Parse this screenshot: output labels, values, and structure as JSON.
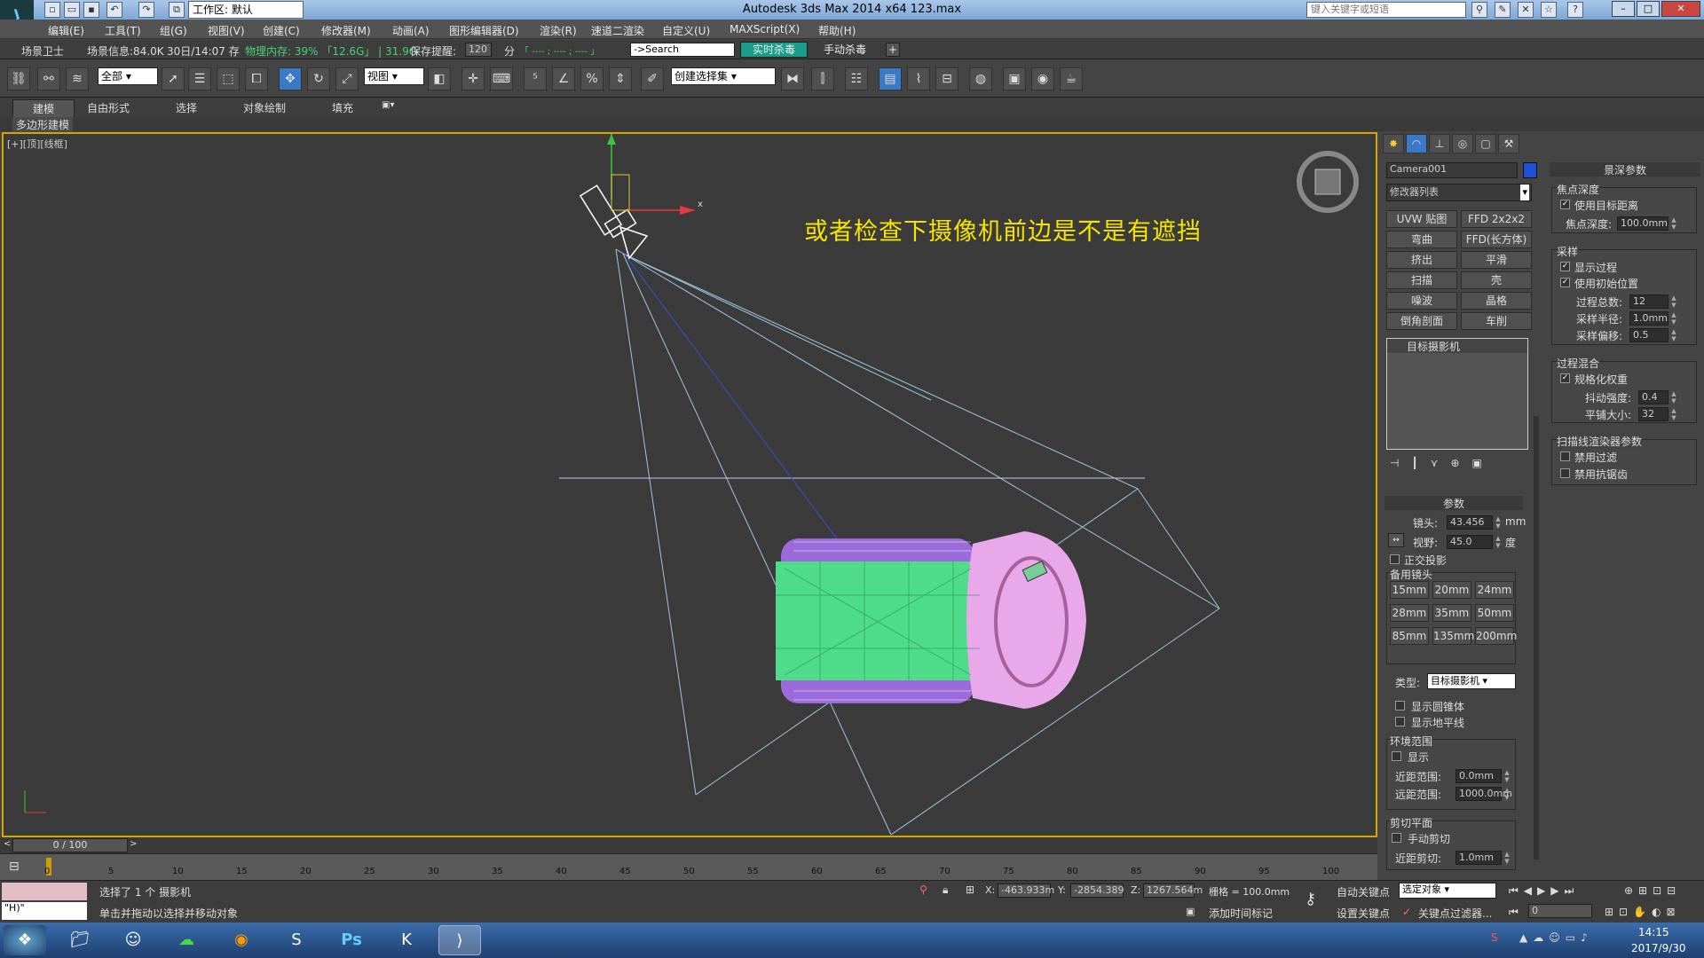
{
  "title_bar": {
    "app": "Autodesk 3ds Max  2014 x64    123.max",
    "workspace": "工作区: 默认",
    "search_placeholder": "键入关键字或短语"
  },
  "menu": [
    "编辑(E)",
    "工具(T)",
    "组(G)",
    "视图(V)",
    "创建(C)",
    "修改器(M)",
    "动画(A)",
    "图形编辑器(D)",
    "渲染(R)",
    "速道二渲染",
    "自定义(U)",
    "MAXScript(X)",
    "帮助(H)"
  ],
  "infobar": {
    "guard": "场景卫士",
    "scene_info": "场景信息:84.0K",
    "save_time": "30日/14:07 存",
    "memory": "物理内存: 39% 「12.6G」 | 31.9G",
    "autosave_label": "保存提醒:",
    "autosave_value": "120",
    "autosave_unit": "分",
    "dashes": "「 ---- ; ---- ; ---- 」",
    "search_value": "->Search",
    "realtime_av": "实时杀毒",
    "manual_av": "手动杀毒",
    "plus": "+"
  },
  "toolbar": {
    "filter": "全部",
    "coord": "视图",
    "selset": "创建选择集"
  },
  "ribbon": {
    "tabs": [
      "建模",
      "自由形式",
      "选择",
      "对象绘制",
      "填充"
    ],
    "sub": "多边形建模"
  },
  "viewport": {
    "label": "[+][顶][线框]",
    "annotation": "或者检查下摄像机前边是不是有遮挡",
    "axis_x": "x"
  },
  "command_panel": {
    "object_name": "Camera001",
    "modifier_list": "修改器列表",
    "modifiers": [
      [
        "UVW 贴图",
        "FFD 2x2x2"
      ],
      [
        "弯曲",
        "FFD(长方体)"
      ],
      [
        "挤出",
        "平滑"
      ],
      [
        "扫描",
        "壳"
      ],
      [
        "噪波",
        "晶格"
      ],
      [
        "倒角剖面",
        "车削"
      ]
    ],
    "stack_item": "目标摄影机",
    "params_title": "参数",
    "lens_label": "镜头:",
    "lens_value": "43.456",
    "lens_unit": "mm",
    "fov_label": "视野:",
    "fov_value": "45.0",
    "fov_unit": "度",
    "ortho": "正交投影",
    "stock_title": "备用镜头",
    "stock": [
      "15mm",
      "20mm",
      "24mm",
      "28mm",
      "35mm",
      "50mm",
      "85mm",
      "135mm",
      "200mm"
    ],
    "type_label": "类型:",
    "type_value": "目标摄影机",
    "show_cone": "显示圆锥体",
    "show_horizon": "显示地平线",
    "env_title": "环境范围",
    "env_show": "显示",
    "near_label": "近距范围:",
    "near_value": "0.0mm",
    "far_label": "远距范围:",
    "far_value": "1000.0mm",
    "clip_title": "剪切平面",
    "manual_clip": "手动剪切",
    "clip_near_label": "近距剪切:",
    "clip_near_value": "1.0mm"
  },
  "dof_panel": {
    "title": "景深参数",
    "focal_title": "焦点深度",
    "use_target": "使用目标距离",
    "focal_label": "焦点深度:",
    "focal_value": "100.0mm",
    "sampling_title": "采样",
    "show_passes": "显示过程",
    "use_initial": "使用初始位置",
    "total_label": "过程总数:",
    "total_value": "12",
    "radius_label": "采样半径:",
    "radius_value": "1.0mm",
    "bias_label": "采样偏移:",
    "bias_value": "0.5",
    "blend_title": "过程混合",
    "normalize": "规格化权重",
    "dither_label": "抖动强度:",
    "dither_value": "0.4",
    "tile_label": "平铺大小:",
    "tile_value": "32",
    "scanline_title": "扫描线渲染器参数",
    "disable_filter": "禁用过滤",
    "disable_aa": "禁用抗锯齿"
  },
  "timeline": {
    "frame": "0 / 100",
    "ticks": [
      "0",
      "5",
      "10",
      "15",
      "20",
      "25",
      "30",
      "35",
      "40",
      "45",
      "50",
      "55",
      "60",
      "65",
      "70",
      "75",
      "80",
      "85",
      "90",
      "95",
      "100"
    ]
  },
  "status": {
    "script": "\"H)\"",
    "selected": "选择了 1 个 摄影机",
    "prompt": "单击并拖动以选择并移动对象",
    "x_label": "X:",
    "x_value": "-463.933m",
    "y_label": "Y:",
    "y_value": "-2854.389",
    "z_label": "Z:",
    "z_value": "1267.564m",
    "grid": "栅格 = 100.0mm",
    "add_tag": "添加时间标记",
    "auto_key": "自动关键点",
    "set_key": "设置关键点",
    "sel_obj": "选定对象",
    "key_filter": "关键点过滤器...",
    "frame_value": "0"
  },
  "taskbar": {
    "time": "14:15",
    "date": "2017/9/30"
  },
  "colors": {
    "accent_yellow": "#d6a600",
    "annotation": "#f6e400",
    "car_green": "#4fdc8a",
    "car_purple": "#9b6bdb",
    "car_pink": "#e9a8ea"
  }
}
